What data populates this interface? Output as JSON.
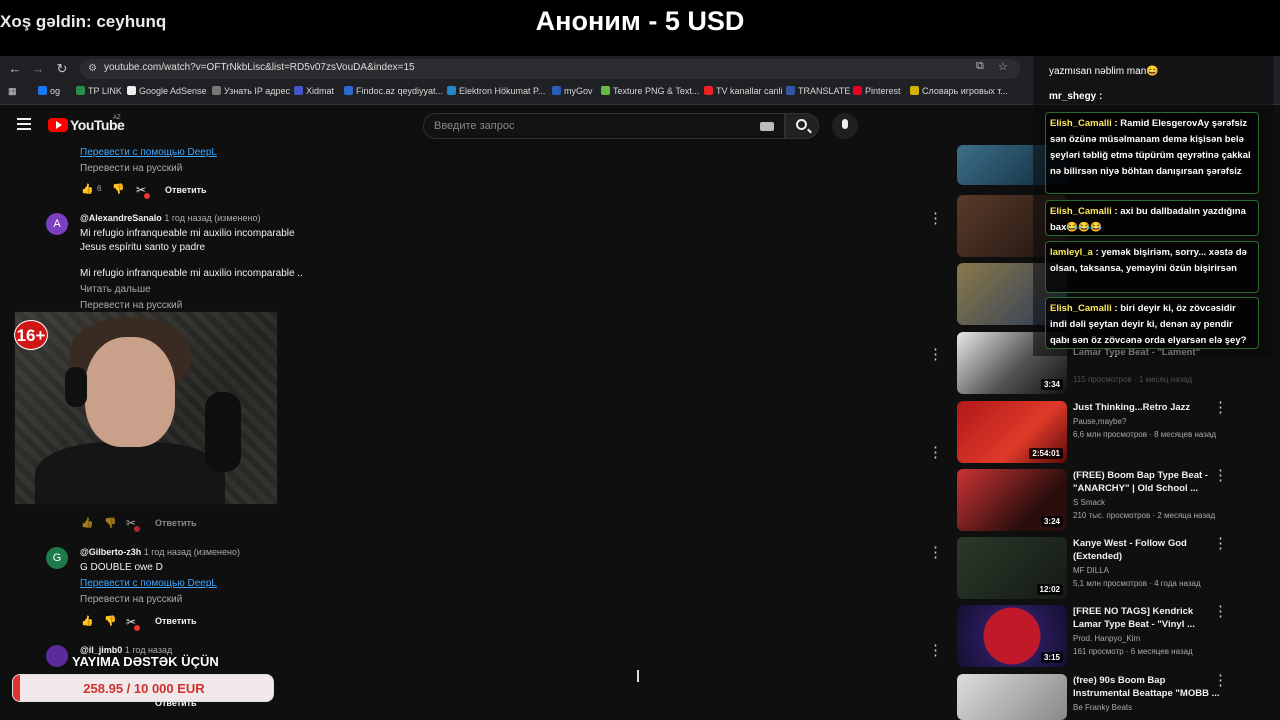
{
  "stream_overlay": {
    "welcome": "Xoş gəldin: ceyhunq",
    "donation": "Аноним - 5 USD",
    "age_badge": "16+",
    "goal_label": "YAYIMA DƏSTƏK ÜÇÜN",
    "goal_text": "258.95 / 10 000 EUR",
    "goal_fraction": 0.0259
  },
  "browser": {
    "url": "youtube.com/watch?v=OFTrNkbLisc&list=RD5v07zsVouDA&index=15",
    "bookmarks": [
      "og",
      "TP LINK",
      "Google AdSense",
      "Узнать IP адрес",
      "Xidmat",
      "Findoc.az qeydiyyat...",
      "Elektron Hökumat P...",
      "myGov",
      "Texture PNG & Text...",
      "TV kanallar canli",
      "TRANSLATE",
      "Pinterest",
      "Словарь игровых т..."
    ]
  },
  "youtube": {
    "logo": "YouTube",
    "region": "AZ",
    "search_placeholder": "Введите запрос"
  },
  "comments": {
    "c0": {
      "translate_link": "Перевести с помощью DeepL",
      "translate_ru": "Перевести на русский",
      "likes": "6",
      "reply": "Ответить"
    },
    "c1": {
      "avatar": "A",
      "author": "@AlexandreSanalo",
      "time": "1 год назад (изменено)",
      "line1": "Mi refugio infranqueable mi auxilio incomparable",
      "line2": "Jesus espíritu santo y padre",
      "line3": "Mi refugio infranqueable mi auxilio incomparable ..",
      "read_more": "Читать дальше",
      "translate_ru": "Перевести на русский",
      "reply": "Ответить"
    },
    "c2": {
      "avatar": "G",
      "author": "@Gilberto-z3h",
      "time": "1 год назад (изменено)",
      "text": "G DOUBLE owe D",
      "translate_link": "Перевести с помощью DeepL",
      "translate_ru": "Перевести на русский",
      "reply": "Ответить"
    },
    "c3": {
      "author": "@il_jimb0",
      "time": "1 год назад",
      "reply": "Ответить"
    }
  },
  "recommended": [
    {
      "title": "Lamar Type Beat - \"Lament\"",
      "channel": "",
      "meta": "115 просмотров · 1 месяц назад",
      "duration": "3:34"
    },
    {
      "title": "Just Thinking...Retro Jazz",
      "channel": "Pause,maybe?",
      "meta": "6,6 млн просмотров · 8 месяцев назад",
      "duration": "2:54:01"
    },
    {
      "title": "(FREE) Boom Bap Type Beat - \"ANARCHY\" | Old School ...",
      "channel": "S Smack",
      "meta": "210 тыс. просмотров · 2 месяца назад",
      "duration": "3:24"
    },
    {
      "title": "Kanye West - Follow God (Extended)",
      "channel": "MF DILLA",
      "meta": "5,1 млн просмотров · 4 года назад",
      "duration": "12:02"
    },
    {
      "title": "[FREE NO TAGS] Kendrick Lamar Type Beat - \"Vinyl ...",
      "channel": "Prod. Hanpyo_Kim",
      "meta": "161 просмотр · 6 месяцев назад",
      "duration": "3:15"
    },
    {
      "title": "(free) 90s Boom Bap Instrumental Beattape \"MOBB ...",
      "channel": "Be Franky Beats",
      "meta": "",
      "duration": ""
    }
  ],
  "chat": {
    "top_line": "yazmısan nəblim man😄",
    "plain_name": "mr_shegy :",
    "messages": [
      {
        "name": "Elish_Camalli",
        "text": ": Ramid ElesgerovAy şərəfsiz sən özünə müsəlmanam demə kişisən belə şeyləri təbliğ etmə tüpürüm qeyrətinə çakkal nə bilirsən niyə böhtan danışırsan şərəfsiz"
      },
      {
        "name": "Elish_Camalli",
        "text": ": axi bu dallbadalın yazdığına bax😂😂😂"
      },
      {
        "name": "lamleyl_a",
        "text": ": yemək bişiriəm, sorry... xəstə də olsan, taksansa, yeməyini özün bişirirsən"
      },
      {
        "name": "Elish_Camalli",
        "text": ": biri deyir ki, öz zövcəsidir indi dəli şeytan deyir ki, denən ay pendir qabı sən öz zövcənə orda elyarsən elə şey?"
      }
    ]
  }
}
